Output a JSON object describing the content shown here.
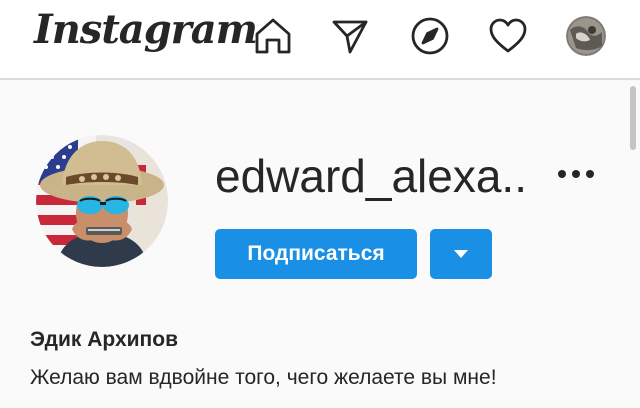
{
  "header": {
    "logo_text": "Instagram",
    "icons": [
      "home-icon",
      "direct-icon",
      "explore-icon",
      "activity-icon",
      "profile-avatar"
    ]
  },
  "profile": {
    "username": "edward_alexa..",
    "follow_label": "Подписаться",
    "full_name": "Эдик Архипов",
    "bio": "Желаю вам вдвойне того, чего желаете вы мне!"
  },
  "colors": {
    "accent": "#1a8fe6",
    "text": "#262626",
    "background": "#fafafa",
    "header_background": "#ffffff",
    "divider": "#dbdbdb"
  }
}
